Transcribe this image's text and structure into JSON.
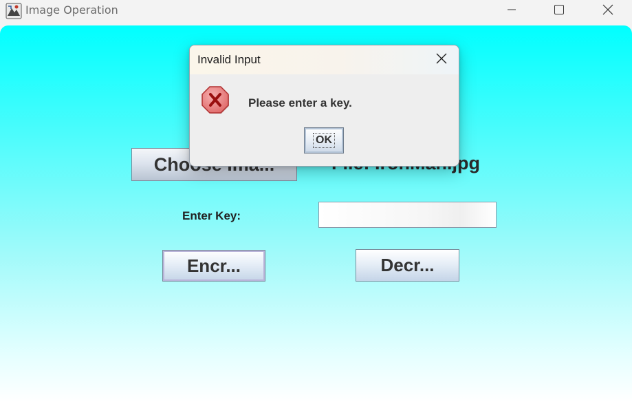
{
  "window": {
    "title": "Image Operation"
  },
  "main": {
    "choose_button_label": "Choose Ima...",
    "file_label": "File: IronMan.jpg",
    "key_label": "Enter Key:",
    "key_input_value": "",
    "encrypt_button_label": "Encr...",
    "decrypt_button_label": "Decr..."
  },
  "dialog": {
    "title": "Invalid Input",
    "message": "Please enter a key.",
    "ok_label": "OK"
  },
  "colors": {
    "background_top": "#00ffff",
    "background_bottom": "#ffffff",
    "error_icon": "#e05555"
  },
  "icons": {
    "app": "java-app-icon",
    "minimize": "minimize-icon",
    "maximize": "maximize-icon",
    "close": "close-icon",
    "dialog_close": "close-icon",
    "error": "error-icon"
  }
}
